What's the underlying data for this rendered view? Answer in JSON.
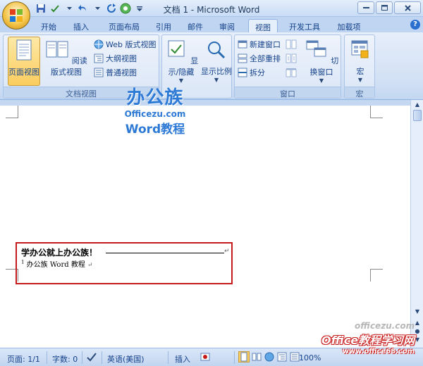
{
  "window": {
    "title": "文档 1 - Microsoft Word"
  },
  "quick_access": {
    "icons": [
      "save-icon",
      "spellcheck-icon",
      "undo-icon",
      "redo-icon",
      "circle-icon",
      "customize-icon"
    ]
  },
  "tabs": [
    {
      "id": "home",
      "label": "开始"
    },
    {
      "id": "insert",
      "label": "插入"
    },
    {
      "id": "page-layout",
      "label": "页面布局"
    },
    {
      "id": "references",
      "label": "引用"
    },
    {
      "id": "mailings",
      "label": "邮件"
    },
    {
      "id": "review",
      "label": "审阅"
    },
    {
      "id": "view",
      "label": "视图",
      "active": true
    },
    {
      "id": "developer",
      "label": "开发工具"
    },
    {
      "id": "addins",
      "label": "加载项"
    }
  ],
  "ribbon": {
    "doc_views": {
      "label": "文档视图",
      "print_layout": "页面视图",
      "full_screen_reading": "阅读版式视图",
      "web_layout": "Web 版式视图",
      "outline": "大纲视图",
      "draft": "普通视图"
    },
    "show_hide": "显示/隐藏",
    "zoom": "显示比例",
    "window_group": {
      "label": "窗口",
      "new_window": "新建窗口",
      "arrange_all": "全部重排",
      "split": "拆分",
      "switch_windows": "切换窗口"
    },
    "macros_group": {
      "label": "宏",
      "macros": "宏"
    }
  },
  "document": {
    "main_text": "学办公就上办公族！",
    "footnote_number": "1",
    "footnote_text": "办公族 Word 教程",
    "para_mark": "↵"
  },
  "watermark_top": {
    "big": "办公族",
    "site": "Officezu.com",
    "sub": "Word教程"
  },
  "watermark_bottom": {
    "site1": "officezu.com",
    "brand": "Office教程学习网",
    "site2": "www.office68.com"
  },
  "status": {
    "page": "页面: 1/1",
    "words": "字数: 0",
    "language": "英语(美国)",
    "insert_mode": "插入",
    "zoom": "100%"
  },
  "colors": {
    "accent": "#15428b",
    "highlight": "#fbcd5f",
    "annotation": "#c51a1a"
  }
}
